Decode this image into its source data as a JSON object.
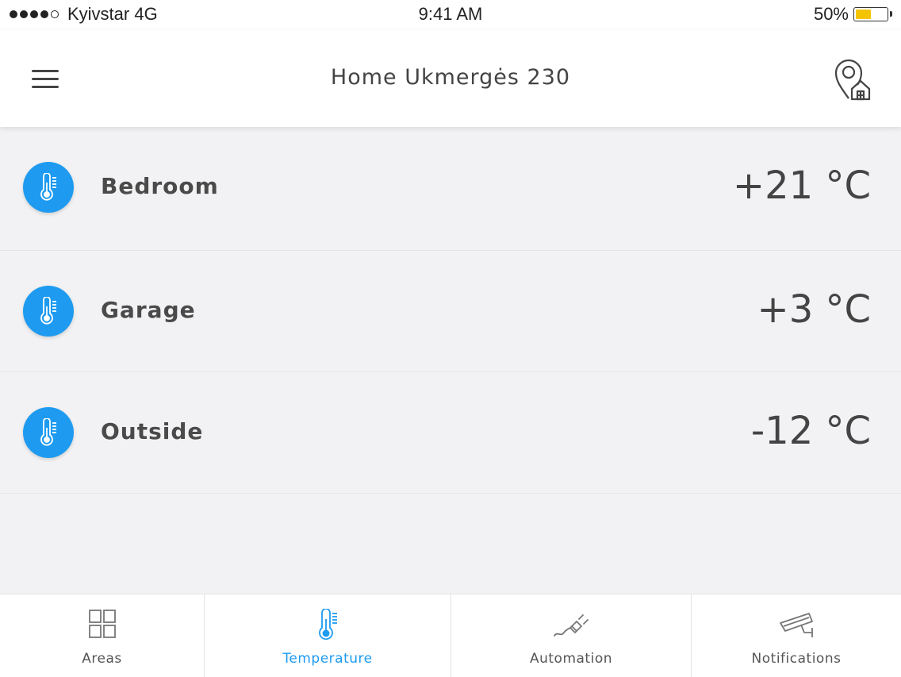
{
  "status_bar": {
    "carrier": "Kyivstar 4G",
    "time": "9:41 AM",
    "battery": "50%",
    "battery_level": 0.5,
    "signal_bars": 4,
    "signal_max": 5,
    "battery_color": "#f5c400"
  },
  "header": {
    "title": "Home Ukmergės 230",
    "menu_icon": "hamburger-menu-icon",
    "location_icon": "location-home-icon"
  },
  "rooms": [
    {
      "name": "Bedroom",
      "temperature": "+21 °C",
      "icon": "thermometer-icon"
    },
    {
      "name": "Garage",
      "temperature": "+3 °C",
      "icon": "thermometer-icon"
    },
    {
      "name": "Outside",
      "temperature": "-12 °C",
      "icon": "thermometer-icon"
    }
  ],
  "tabs": [
    {
      "label": "Areas",
      "icon": "grid-icon",
      "active": false
    },
    {
      "label": "Temperature",
      "icon": "thermometer-icon",
      "active": true
    },
    {
      "label": "Automation",
      "icon": "plug-icon",
      "active": false
    },
    {
      "label": "Notifications",
      "icon": "security-camera-icon",
      "active": false
    }
  ],
  "colors": {
    "accent": "#1e9bf0",
    "background": "#f2f2f4",
    "text": "#444444"
  }
}
